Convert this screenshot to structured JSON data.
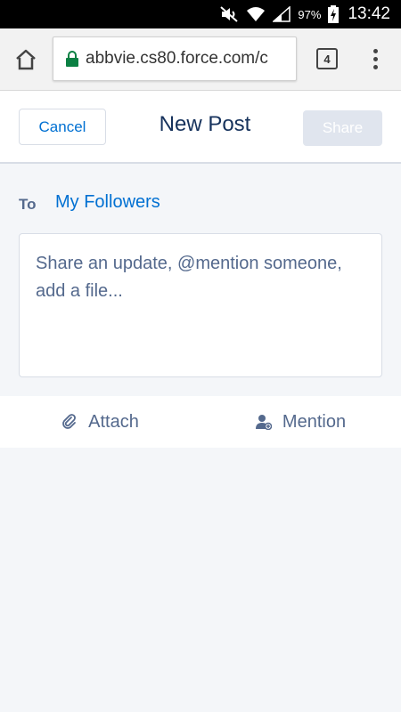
{
  "status_bar": {
    "battery_percent": "97%",
    "time": "13:42"
  },
  "browser": {
    "url": "abbvie.cs80.force.com/c",
    "tab_count": "4"
  },
  "post_header": {
    "cancel_label": "Cancel",
    "title": "New Post",
    "share_label": "Share"
  },
  "composer": {
    "to_label": "To",
    "to_value": "My Followers",
    "placeholder": "Share an update, @mention someone, add a file..."
  },
  "actions": {
    "attach_label": "Attach",
    "mention_label": "Mention"
  },
  "colors": {
    "link_blue": "#0070d2",
    "title_navy": "#16325c",
    "muted_text": "#54698d",
    "disabled_button": "#e0e5ee",
    "page_background": "#f4f6f9"
  },
  "icons": [
    "mute-icon",
    "wifi-icon",
    "signal-icon",
    "battery-icon",
    "home-icon",
    "lock-icon",
    "tabs-icon",
    "overflow-menu-icon",
    "paperclip-icon",
    "add-user-icon"
  ]
}
